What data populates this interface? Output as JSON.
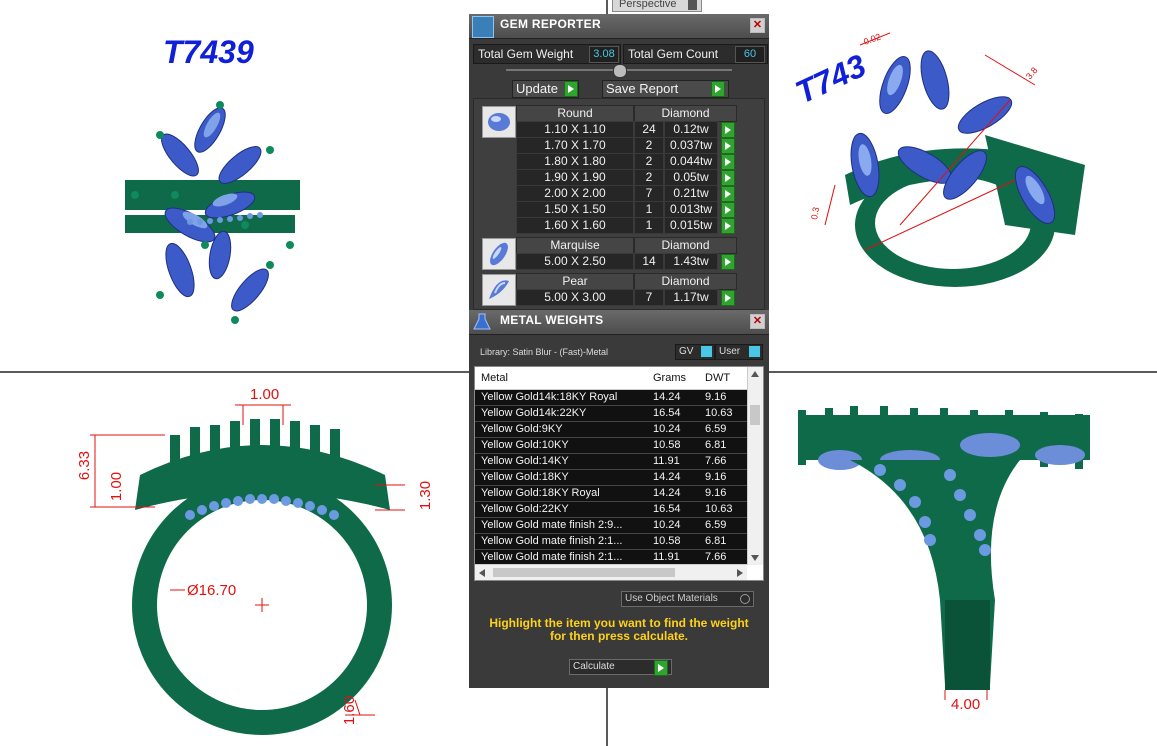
{
  "viewport": {
    "label": "Perspective",
    "model_label_top_left": "T7439",
    "model_label_top_right": "T743",
    "dimensions": {
      "dim_width_top": "1.00",
      "dim_height_left": "6.33",
      "dim_height_left2": "1.00",
      "dim_right": "1.30",
      "dim_diameter": "Ø16.70",
      "dim_bottom": "1.60",
      "dim_shank": "4.00",
      "dim_tr_a": "0.02",
      "dim_tr_b": "3.8",
      "dim_tr_c": "0.3"
    }
  },
  "gem_reporter": {
    "title": "GEM REPORTER",
    "total_weight_label": "Total Gem Weight",
    "total_weight_value": "3.08",
    "total_count_label": "Total Gem Count",
    "total_count_value": "60",
    "update_label": "Update",
    "save_report_label": "Save Report",
    "groups": [
      {
        "shape": "Round",
        "material": "Diamond",
        "rows": [
          {
            "size": "1.10 X 1.10",
            "count": "24",
            "weight": "0.12tw"
          },
          {
            "size": "1.70 X 1.70",
            "count": "2",
            "weight": "0.037tw"
          },
          {
            "size": "1.80 X 1.80",
            "count": "2",
            "weight": "0.044tw"
          },
          {
            "size": "1.90 X 1.90",
            "count": "2",
            "weight": "0.05tw"
          },
          {
            "size": "2.00 X 2.00",
            "count": "7",
            "weight": "0.21tw"
          },
          {
            "size": "1.50 X 1.50",
            "count": "1",
            "weight": "0.013tw"
          },
          {
            "size": "1.60 X 1.60",
            "count": "1",
            "weight": "0.015tw"
          }
        ]
      },
      {
        "shape": "Marquise",
        "material": "Diamond",
        "rows": [
          {
            "size": "5.00 X 2.50",
            "count": "14",
            "weight": "1.43tw"
          }
        ]
      },
      {
        "shape": "Pear",
        "material": "Diamond",
        "rows": [
          {
            "size": "5.00 X 3.00",
            "count": "7",
            "weight": "1.17tw"
          }
        ]
      }
    ]
  },
  "metal_weights": {
    "title": "METAL WEIGHTS",
    "library": "Library: Satin Blur - (Fast)-Metal",
    "gv_label": "GV",
    "user_label": "User",
    "columns": [
      "Metal",
      "Grams",
      "DWT"
    ],
    "rows": [
      {
        "metal": "Yellow Gold14k:18KY Royal",
        "grams": "14.24",
        "dwt": "9.16"
      },
      {
        "metal": "Yellow Gold14k:22KY",
        "grams": "16.54",
        "dwt": "10.63"
      },
      {
        "metal": "Yellow Gold:9KY",
        "grams": "10.24",
        "dwt": "6.59"
      },
      {
        "metal": "Yellow Gold:10KY",
        "grams": "10.58",
        "dwt": "6.81"
      },
      {
        "metal": "Yellow Gold:14KY",
        "grams": "11.91",
        "dwt": "7.66"
      },
      {
        "metal": "Yellow Gold:18KY",
        "grams": "14.24",
        "dwt": "9.16"
      },
      {
        "metal": "Yellow Gold:18KY Royal",
        "grams": "14.24",
        "dwt": "9.16"
      },
      {
        "metal": "Yellow Gold:22KY",
        "grams": "16.54",
        "dwt": "10.63"
      },
      {
        "metal": "Yellow Gold mate finish 2:9...",
        "grams": "10.24",
        "dwt": "6.59"
      },
      {
        "metal": "Yellow Gold mate finish 2:1...",
        "grams": "10.58",
        "dwt": "6.81"
      },
      {
        "metal": "Yellow Gold mate finish 2:1...",
        "grams": "11.91",
        "dwt": "7.66"
      }
    ],
    "use_object_materials_label": "Use Object Materials",
    "hint_line1": "Highlight the item you want to find the weight",
    "hint_line2": "for then press calculate.",
    "calculate_label": "Calculate"
  },
  "colors": {
    "metal_green": "#0f6a4a",
    "gem_blue": "#5a7ad8",
    "dimension_red": "#e01010",
    "label_blue": "#1020d8",
    "value_cyan": "#49c7e6",
    "hint_yellow": "#ffd21a"
  }
}
